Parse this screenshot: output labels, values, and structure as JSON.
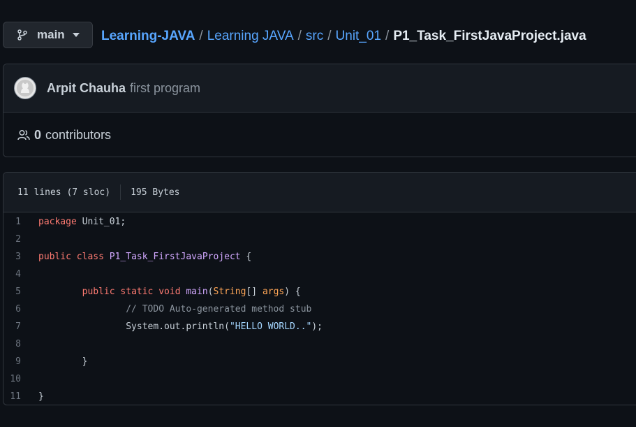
{
  "branch": {
    "name": "main"
  },
  "breadcrumb": {
    "repo": "Learning-JAVA",
    "parts": [
      "Learning JAVA",
      "src",
      "Unit_01"
    ],
    "separator": "/",
    "file": "P1_Task_FirstJavaProject.java"
  },
  "commit": {
    "author": "Arpit Chauha",
    "message": "first program"
  },
  "contributors": {
    "count": "0",
    "label": "contributors"
  },
  "file_info": {
    "lines": "11 lines (7 sloc)",
    "size": "195 Bytes"
  },
  "code": {
    "line_numbers": [
      "1",
      "2",
      "3",
      "4",
      "5",
      "6",
      "7",
      "8",
      "9",
      "10",
      "11"
    ],
    "l1": {
      "kw": "package",
      "rest": " Unit_01;"
    },
    "l3": {
      "kw1": "public",
      "kw2": "class",
      "cls": "P1_Task_FirstJavaProject",
      "rest": " {"
    },
    "l5": {
      "indent": "        ",
      "kw1": "public",
      "kw2": "static",
      "kw3": "void",
      "fn": "main",
      "open": "(",
      "type": "String",
      "mid": "[] ",
      "param": "args",
      "close": ") {"
    },
    "l6": {
      "indent": "                ",
      "comment": "// TODO Auto-generated method stub"
    },
    "l7": {
      "indent": "                ",
      "call": "System.out.println(",
      "str": "\"HELLO WORLD..\"",
      "end": ");"
    },
    "l9": {
      "indent": "        ",
      "text": "}"
    },
    "l11": {
      "text": "}"
    }
  },
  "colors": {
    "background": "#0d1117",
    "link": "#58a6ff",
    "keyword": "#ff7b72",
    "class_name": "#d2a8ff",
    "parameter": "#ffa657",
    "comment": "#8b949e",
    "string": "#a5d6ff"
  }
}
